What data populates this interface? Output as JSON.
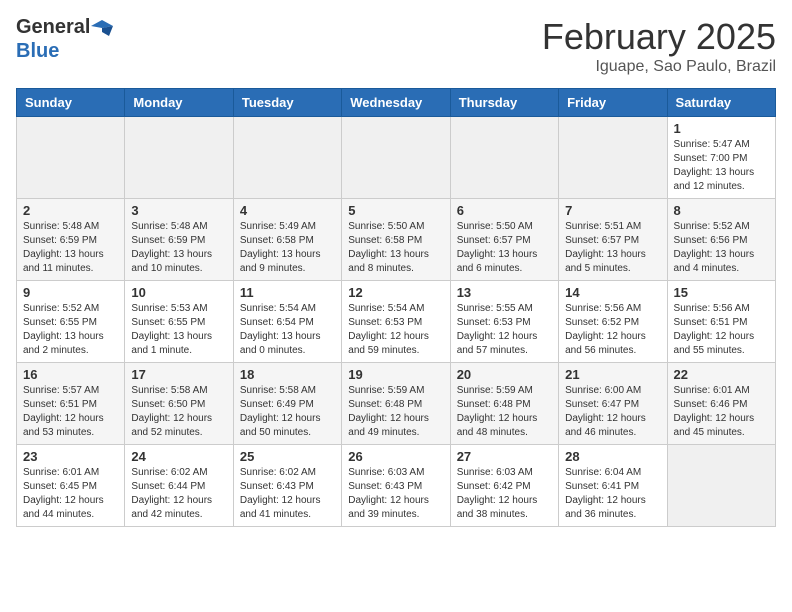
{
  "header": {
    "logo_general": "General",
    "logo_blue": "Blue",
    "month_title": "February 2025",
    "location": "Iguape, Sao Paulo, Brazil"
  },
  "weekdays": [
    "Sunday",
    "Monday",
    "Tuesday",
    "Wednesday",
    "Thursday",
    "Friday",
    "Saturday"
  ],
  "weeks": [
    [
      {
        "day": "",
        "info": ""
      },
      {
        "day": "",
        "info": ""
      },
      {
        "day": "",
        "info": ""
      },
      {
        "day": "",
        "info": ""
      },
      {
        "day": "",
        "info": ""
      },
      {
        "day": "",
        "info": ""
      },
      {
        "day": "1",
        "info": "Sunrise: 5:47 AM\nSunset: 7:00 PM\nDaylight: 13 hours\nand 12 minutes."
      }
    ],
    [
      {
        "day": "2",
        "info": "Sunrise: 5:48 AM\nSunset: 6:59 PM\nDaylight: 13 hours\nand 11 minutes."
      },
      {
        "day": "3",
        "info": "Sunrise: 5:48 AM\nSunset: 6:59 PM\nDaylight: 13 hours\nand 10 minutes."
      },
      {
        "day": "4",
        "info": "Sunrise: 5:49 AM\nSunset: 6:58 PM\nDaylight: 13 hours\nand 9 minutes."
      },
      {
        "day": "5",
        "info": "Sunrise: 5:50 AM\nSunset: 6:58 PM\nDaylight: 13 hours\nand 8 minutes."
      },
      {
        "day": "6",
        "info": "Sunrise: 5:50 AM\nSunset: 6:57 PM\nDaylight: 13 hours\nand 6 minutes."
      },
      {
        "day": "7",
        "info": "Sunrise: 5:51 AM\nSunset: 6:57 PM\nDaylight: 13 hours\nand 5 minutes."
      },
      {
        "day": "8",
        "info": "Sunrise: 5:52 AM\nSunset: 6:56 PM\nDaylight: 13 hours\nand 4 minutes."
      }
    ],
    [
      {
        "day": "9",
        "info": "Sunrise: 5:52 AM\nSunset: 6:55 PM\nDaylight: 13 hours\nand 2 minutes."
      },
      {
        "day": "10",
        "info": "Sunrise: 5:53 AM\nSunset: 6:55 PM\nDaylight: 13 hours\nand 1 minute."
      },
      {
        "day": "11",
        "info": "Sunrise: 5:54 AM\nSunset: 6:54 PM\nDaylight: 13 hours\nand 0 minutes."
      },
      {
        "day": "12",
        "info": "Sunrise: 5:54 AM\nSunset: 6:53 PM\nDaylight: 12 hours\nand 59 minutes."
      },
      {
        "day": "13",
        "info": "Sunrise: 5:55 AM\nSunset: 6:53 PM\nDaylight: 12 hours\nand 57 minutes."
      },
      {
        "day": "14",
        "info": "Sunrise: 5:56 AM\nSunset: 6:52 PM\nDaylight: 12 hours\nand 56 minutes."
      },
      {
        "day": "15",
        "info": "Sunrise: 5:56 AM\nSunset: 6:51 PM\nDaylight: 12 hours\nand 55 minutes."
      }
    ],
    [
      {
        "day": "16",
        "info": "Sunrise: 5:57 AM\nSunset: 6:51 PM\nDaylight: 12 hours\nand 53 minutes."
      },
      {
        "day": "17",
        "info": "Sunrise: 5:58 AM\nSunset: 6:50 PM\nDaylight: 12 hours\nand 52 minutes."
      },
      {
        "day": "18",
        "info": "Sunrise: 5:58 AM\nSunset: 6:49 PM\nDaylight: 12 hours\nand 50 minutes."
      },
      {
        "day": "19",
        "info": "Sunrise: 5:59 AM\nSunset: 6:48 PM\nDaylight: 12 hours\nand 49 minutes."
      },
      {
        "day": "20",
        "info": "Sunrise: 5:59 AM\nSunset: 6:48 PM\nDaylight: 12 hours\nand 48 minutes."
      },
      {
        "day": "21",
        "info": "Sunrise: 6:00 AM\nSunset: 6:47 PM\nDaylight: 12 hours\nand 46 minutes."
      },
      {
        "day": "22",
        "info": "Sunrise: 6:01 AM\nSunset: 6:46 PM\nDaylight: 12 hours\nand 45 minutes."
      }
    ],
    [
      {
        "day": "23",
        "info": "Sunrise: 6:01 AM\nSunset: 6:45 PM\nDaylight: 12 hours\nand 44 minutes."
      },
      {
        "day": "24",
        "info": "Sunrise: 6:02 AM\nSunset: 6:44 PM\nDaylight: 12 hours\nand 42 minutes."
      },
      {
        "day": "25",
        "info": "Sunrise: 6:02 AM\nSunset: 6:43 PM\nDaylight: 12 hours\nand 41 minutes."
      },
      {
        "day": "26",
        "info": "Sunrise: 6:03 AM\nSunset: 6:43 PM\nDaylight: 12 hours\nand 39 minutes."
      },
      {
        "day": "27",
        "info": "Sunrise: 6:03 AM\nSunset: 6:42 PM\nDaylight: 12 hours\nand 38 minutes."
      },
      {
        "day": "28",
        "info": "Sunrise: 6:04 AM\nSunset: 6:41 PM\nDaylight: 12 hours\nand 36 minutes."
      },
      {
        "day": "",
        "info": ""
      }
    ]
  ]
}
